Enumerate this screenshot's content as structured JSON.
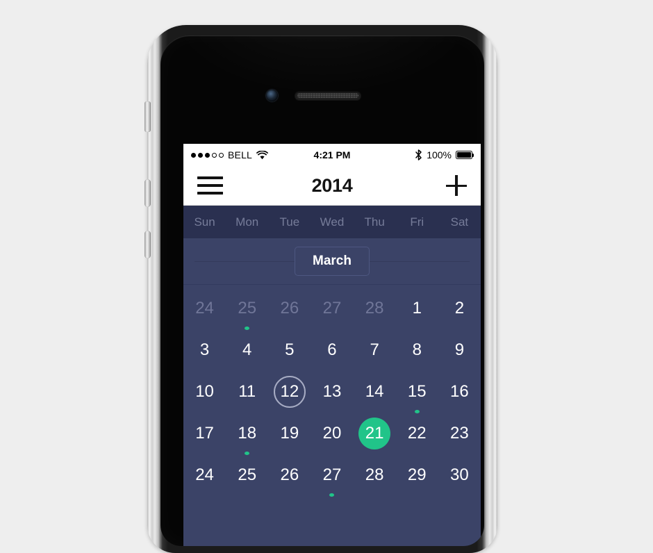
{
  "device": {
    "type": "smartphone",
    "buttons": [
      "power-button",
      "mute-switch",
      "volume-up",
      "volume-down"
    ]
  },
  "status_bar": {
    "signal_dots_filled": 3,
    "signal_dots_total": 5,
    "carrier": "BELL",
    "wifi_icon": "wifi-icon",
    "time": "4:21 PM",
    "bluetooth_icon": "bluetooth-icon",
    "battery_percent": "100%",
    "battery_icon": "battery-full-icon"
  },
  "nav_bar": {
    "menu_icon": "hamburger-menu-icon",
    "title": "2014",
    "add_icon": "plus-icon"
  },
  "calendar": {
    "weekdays": [
      "Sun",
      "Mon",
      "Tue",
      "Wed",
      "Thu",
      "Fri",
      "Sat"
    ],
    "month": "March",
    "colors": {
      "header_bg": "#2a3050",
      "body_bg": "#3b4367",
      "accent_green": "#21c489",
      "muted_day": "#707698",
      "weekday_label": "#767c99"
    },
    "weeks": [
      [
        {
          "day": "24",
          "muted": true,
          "today": false,
          "selected": false,
          "event": false
        },
        {
          "day": "25",
          "muted": true,
          "today": false,
          "selected": false,
          "event": true
        },
        {
          "day": "26",
          "muted": true,
          "today": false,
          "selected": false,
          "event": false
        },
        {
          "day": "27",
          "muted": true,
          "today": false,
          "selected": false,
          "event": false
        },
        {
          "day": "28",
          "muted": true,
          "today": false,
          "selected": false,
          "event": false
        },
        {
          "day": "1",
          "muted": false,
          "today": false,
          "selected": false,
          "event": false
        },
        {
          "day": "2",
          "muted": false,
          "today": false,
          "selected": false,
          "event": false
        }
      ],
      [
        {
          "day": "3",
          "muted": false,
          "today": false,
          "selected": false,
          "event": false
        },
        {
          "day": "4",
          "muted": false,
          "today": false,
          "selected": false,
          "event": false
        },
        {
          "day": "5",
          "muted": false,
          "today": false,
          "selected": false,
          "event": false
        },
        {
          "day": "6",
          "muted": false,
          "today": false,
          "selected": false,
          "event": false
        },
        {
          "day": "7",
          "muted": false,
          "today": false,
          "selected": false,
          "event": false
        },
        {
          "day": "8",
          "muted": false,
          "today": false,
          "selected": false,
          "event": false
        },
        {
          "day": "9",
          "muted": false,
          "today": false,
          "selected": false,
          "event": false
        }
      ],
      [
        {
          "day": "10",
          "muted": false,
          "today": false,
          "selected": false,
          "event": false
        },
        {
          "day": "11",
          "muted": false,
          "today": false,
          "selected": false,
          "event": false
        },
        {
          "day": "12",
          "muted": false,
          "today": true,
          "selected": false,
          "event": false
        },
        {
          "day": "13",
          "muted": false,
          "today": false,
          "selected": false,
          "event": false
        },
        {
          "day": "14",
          "muted": false,
          "today": false,
          "selected": false,
          "event": false
        },
        {
          "day": "15",
          "muted": false,
          "today": false,
          "selected": false,
          "event": true
        },
        {
          "day": "16",
          "muted": false,
          "today": false,
          "selected": false,
          "event": false
        }
      ],
      [
        {
          "day": "17",
          "muted": false,
          "today": false,
          "selected": false,
          "event": false
        },
        {
          "day": "18",
          "muted": false,
          "today": false,
          "selected": false,
          "event": true
        },
        {
          "day": "19",
          "muted": false,
          "today": false,
          "selected": false,
          "event": false
        },
        {
          "day": "20",
          "muted": false,
          "today": false,
          "selected": false,
          "event": false
        },
        {
          "day": "21",
          "muted": false,
          "today": false,
          "selected": true,
          "event": false
        },
        {
          "day": "22",
          "muted": false,
          "today": false,
          "selected": false,
          "event": false
        },
        {
          "day": "23",
          "muted": false,
          "today": false,
          "selected": false,
          "event": false
        }
      ],
      [
        {
          "day": "24",
          "muted": false,
          "today": false,
          "selected": false,
          "event": false
        },
        {
          "day": "25",
          "muted": false,
          "today": false,
          "selected": false,
          "event": false
        },
        {
          "day": "26",
          "muted": false,
          "today": false,
          "selected": false,
          "event": false
        },
        {
          "day": "27",
          "muted": false,
          "today": false,
          "selected": false,
          "event": true
        },
        {
          "day": "28",
          "muted": false,
          "today": false,
          "selected": false,
          "event": false
        },
        {
          "day": "29",
          "muted": false,
          "today": false,
          "selected": false,
          "event": false
        },
        {
          "day": "30",
          "muted": false,
          "today": false,
          "selected": false,
          "event": false
        }
      ]
    ]
  }
}
